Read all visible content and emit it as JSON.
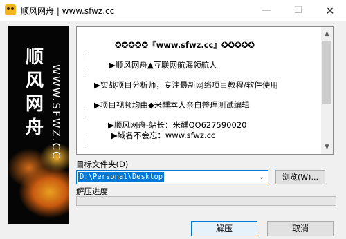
{
  "window": {
    "title": "顺风网舟 | www.sfwz.cc",
    "minimize": "—",
    "maximize": "☐",
    "close": "✕",
    "icon": "app-icon"
  },
  "banner": {
    "name": "顺风网舟",
    "site": "WWW.SFWZ.CC"
  },
  "info": {
    "lines": [
      "✪✪✪✪✪『www.sfwz.cc』✪✪✪✪✪",
      "▶顺风网舟▲互联网航海领航人",
      "▶实战项目分析师，专注最新网络项目教程/软件使用",
      "▶项目视频均由◆米醺本人亲自整理测试编辑",
      "▶顺风网舟-站长：米醺QQ627590020",
      "▶域名不会忘：www.sfwz.cc"
    ],
    "scroll_up": "▲",
    "scroll_down": "▼"
  },
  "target": {
    "label": "目标文件夹(D)",
    "path": "D:\\Personal\\Desktop",
    "browse_label": "浏览(W)...",
    "dropdown_arrow": "⌄"
  },
  "progress": {
    "label": "解压进度",
    "value_fraction": 0
  },
  "actions": {
    "ok_label": "解压",
    "cancel_label": "取消"
  }
}
